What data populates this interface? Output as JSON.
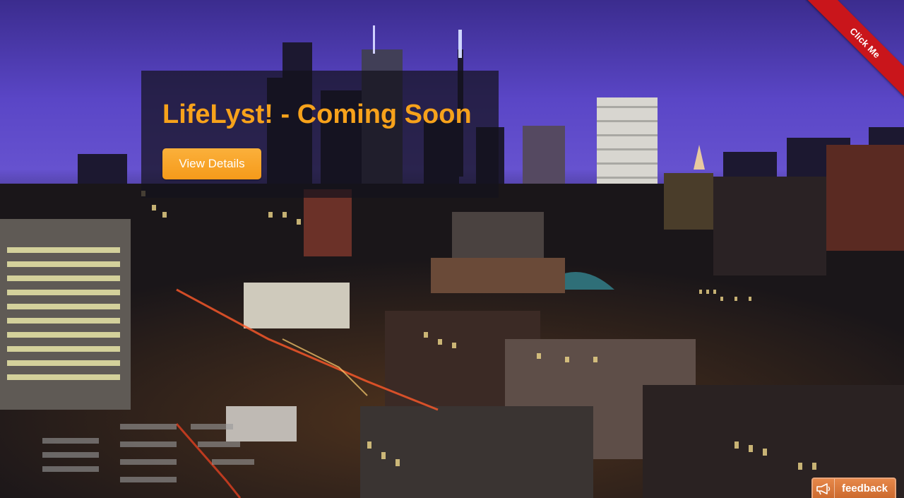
{
  "hero": {
    "title": "LifeLyst! - Coming Soon",
    "button_label": "View Details"
  },
  "ribbon": {
    "label": "Click Me"
  },
  "feedback": {
    "label": "feedback",
    "icon": "megaphone-icon"
  },
  "background": {
    "description_icon": "city-skyline-image"
  },
  "colors": {
    "accent": "#f7a21b",
    "ribbon": "#c9151b",
    "feedback": "#d9773a"
  }
}
